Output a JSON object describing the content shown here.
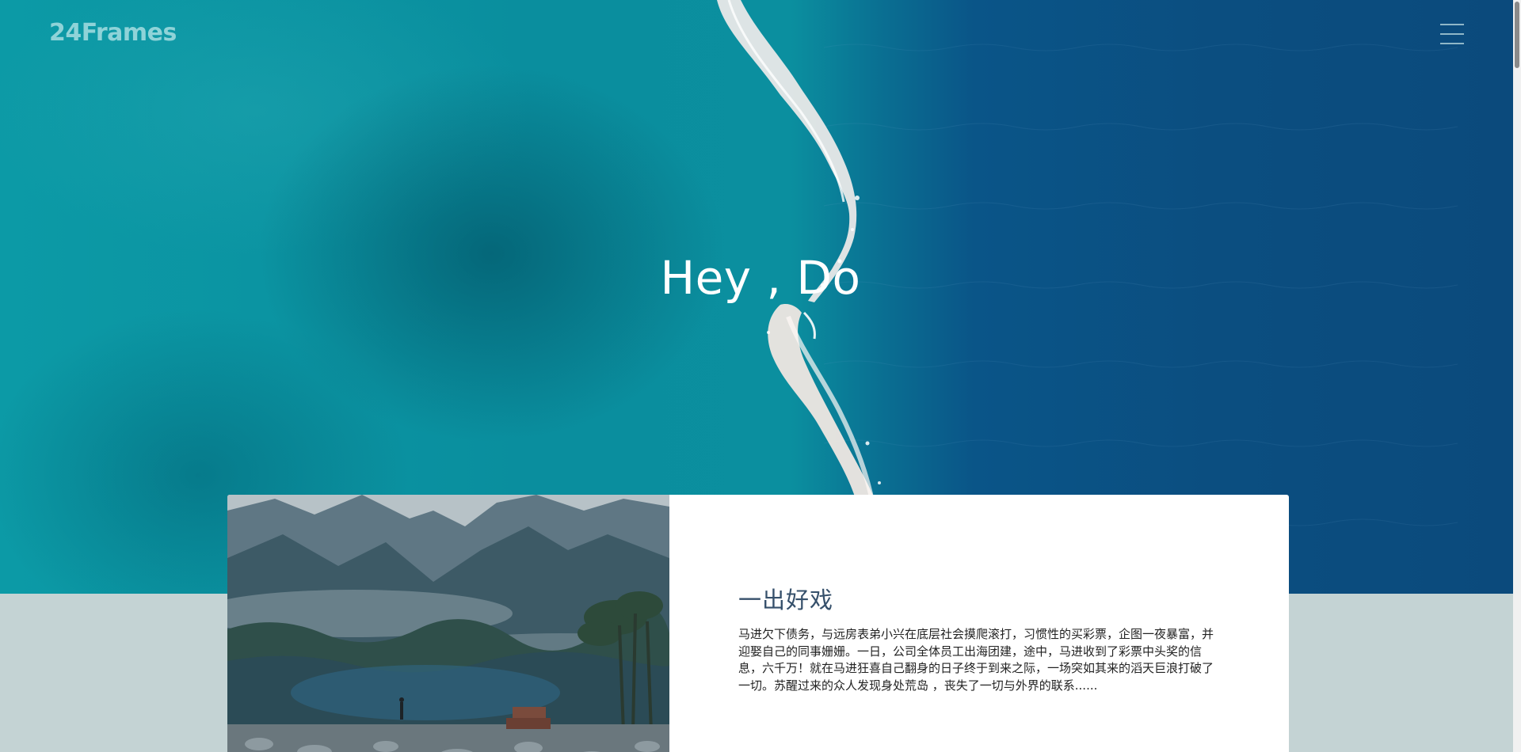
{
  "header": {
    "logo": "24Frames",
    "menu_icon": "hamburger-menu-icon"
  },
  "hero": {
    "title": "Hey , Do"
  },
  "card": {
    "title": "一出好戏",
    "description": "马进欠下债务，与远房表弟小兴在底层社会摸爬滚打，习惯性的买彩票，企图一夜暴富，并迎娶自己的同事姗姗。一日，公司全体员工出海团建，途中，马进收到了彩票中头奖的信息，六千万！就在马进狂喜自己翻身的日子终于到来之际，一场突如其来的滔天巨浪打破了一切。苏醒过来的众人发现身处荒岛 ，丧失了一切与外界的联系......"
  },
  "colors": {
    "logo": "#8fd3d8",
    "hero_left_water": "#0b96a3",
    "hero_right_water": "#0b4a7c",
    "page_background": "#c4d3d4",
    "card_title": "#36506b"
  }
}
